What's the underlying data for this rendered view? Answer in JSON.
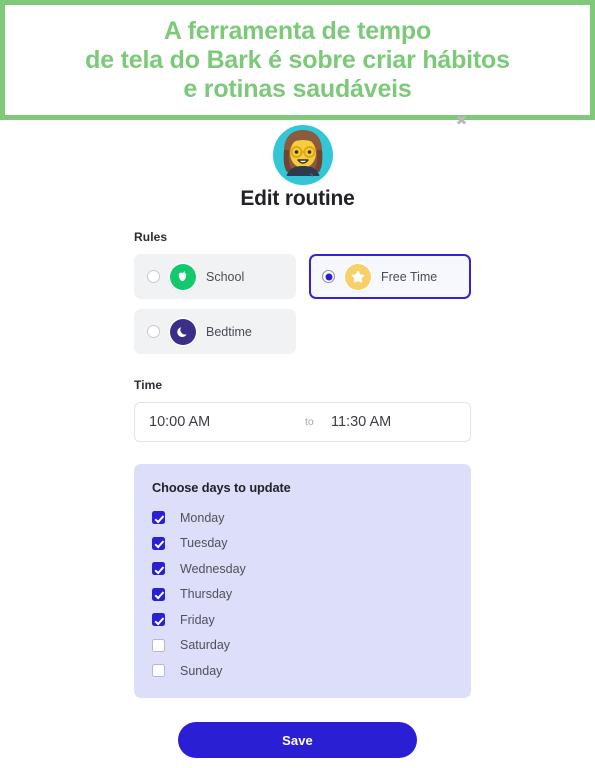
{
  "banner": {
    "text": "A ferramenta de tempo\nde tela do Bark é sobre criar hábitos\ne rotinas saudáveis",
    "border_color": "#80c97b",
    "text_color": "#7dc97a",
    "artifact_glyph": "✖"
  },
  "avatar": {
    "icon_name": "woman-with-glasses-avatar",
    "background_color": "#32c6d6",
    "hair_color": "#8c5a3c",
    "face_color": "#f6ce3d",
    "shirt_color": "#2e3a4e"
  },
  "title": "Edit routine",
  "rules": {
    "label": "Rules",
    "options": [
      {
        "label": "School",
        "selected": false,
        "icon_name": "apple-icon",
        "icon_bg": "#12c96e",
        "icon_fg": "#ffffff"
      },
      {
        "label": "Free Time",
        "selected": true,
        "icon_name": "star-icon",
        "icon_bg": "#f8d06a",
        "icon_fg": "#ffffff"
      },
      {
        "label": "Bedtime",
        "selected": false,
        "icon_name": "moon-icon",
        "icon_bg": "#3b2d8a",
        "icon_fg": "#ffffff"
      }
    ],
    "selected_border_color": "#3521d6"
  },
  "time": {
    "label": "Time",
    "start_value": "10:00 AM",
    "separator": "to",
    "end_value": "11:30 AM"
  },
  "days": {
    "title": "Choose days to update",
    "panel_color": "#dcdefa",
    "items": [
      {
        "label": "Monday",
        "checked": true
      },
      {
        "label": "Tuesday",
        "checked": true
      },
      {
        "label": "Wednesday",
        "checked": true
      },
      {
        "label": "Thursday",
        "checked": true
      },
      {
        "label": "Friday",
        "checked": true
      },
      {
        "label": "Saturday",
        "checked": false
      },
      {
        "label": "Sunday",
        "checked": false
      }
    ]
  },
  "save": {
    "label": "Save",
    "color": "#2b1fd4"
  }
}
